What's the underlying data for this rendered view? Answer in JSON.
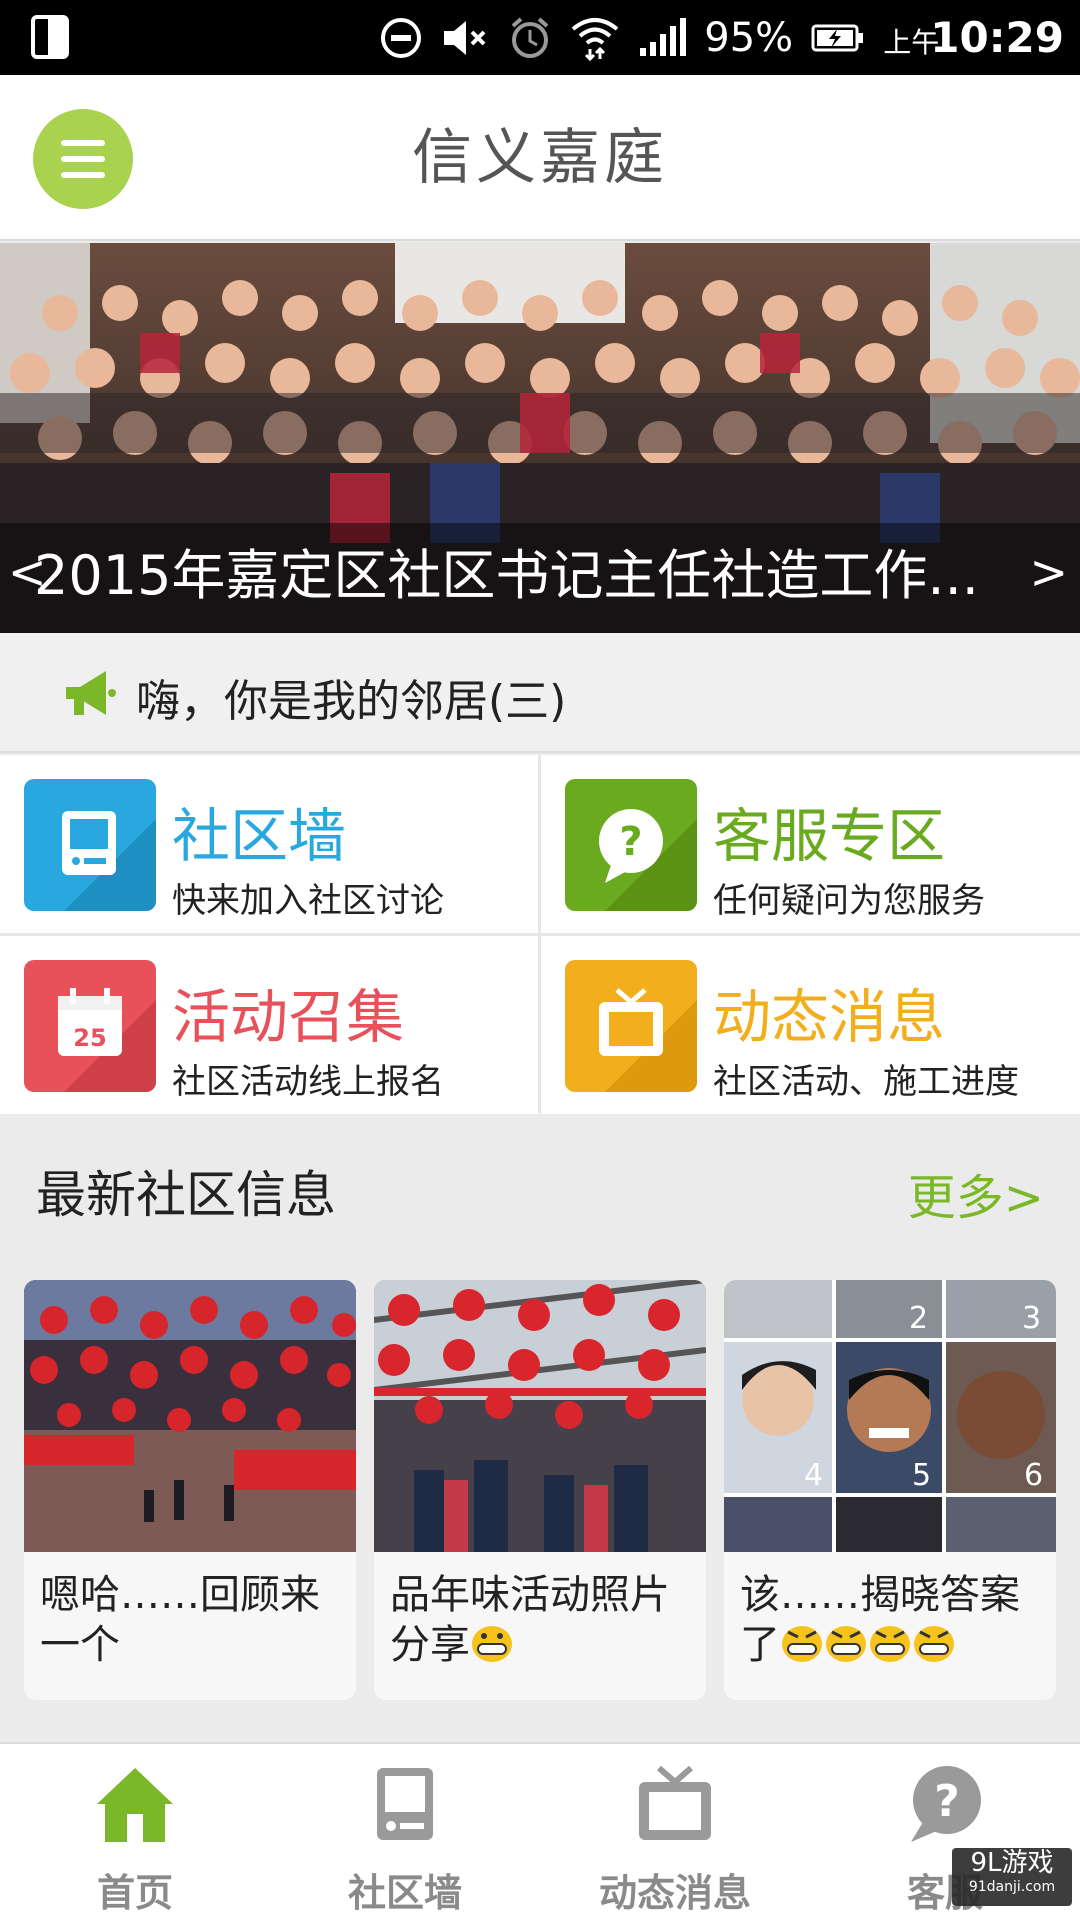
{
  "status_bar": {
    "battery_percent": "95%",
    "am_pm": "上午",
    "time": "10:29"
  },
  "app": {
    "title": "信义嘉庭",
    "menu_icon": "hamburger-icon",
    "accent_color": "#a9d24f"
  },
  "banner": {
    "caption": "2015年嘉定区社区书记主任社造工作...",
    "prev_glyph": "<",
    "next_glyph": ">"
  },
  "notice": {
    "icon": "megaphone-icon",
    "text": "嗨，你是我的邻居(三)"
  },
  "grid": [
    {
      "title": "社区墙",
      "subtitle": "快来加入社区讨论",
      "color": "#29a8e0",
      "icon": "wall-board-icon"
    },
    {
      "title": "客服专区",
      "subtitle": "任何疑问为您服务",
      "color": "#6aaa1e",
      "icon": "question-bubble-icon"
    },
    {
      "title": "活动召集",
      "subtitle": "社区活动线上报名",
      "color": "#e8515a",
      "icon": "calendar-icon",
      "calendar_day": "25"
    },
    {
      "title": "动态消息",
      "subtitle": "社区活动、施工进度",
      "color": "#f2ae1c",
      "icon": "tv-icon"
    }
  ],
  "section": {
    "title": "最新社区信息",
    "more": "更多>"
  },
  "cards": [
    {
      "title": "嗯哈……回顾来一个"
    },
    {
      "title": "品年味活动照片分享"
    },
    {
      "title": "该……揭晓答案了"
    }
  ],
  "photo_numbers": [
    "2",
    "3",
    "4",
    "5",
    "6"
  ],
  "bottom_nav": [
    {
      "label": "首页",
      "icon": "home-icon",
      "active": true
    },
    {
      "label": "社区墙",
      "icon": "wall-board-icon",
      "active": false
    },
    {
      "label": "动态消息",
      "icon": "tv-icon",
      "active": false
    },
    {
      "label": "客服",
      "icon": "question-bubble-icon",
      "active": false
    }
  ],
  "watermark": {
    "brand": "9L游戏",
    "url": "91danji.com"
  }
}
